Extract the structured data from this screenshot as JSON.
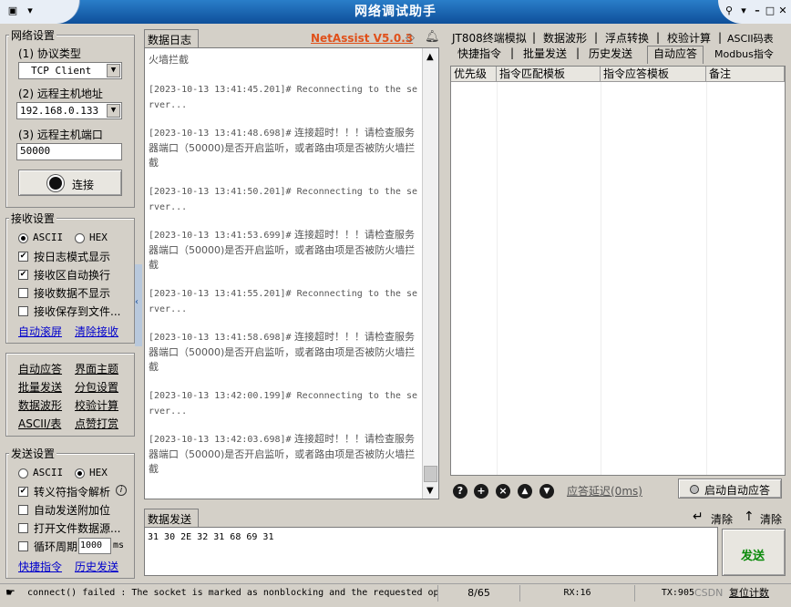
{
  "window": {
    "title": "网络调试助手"
  },
  "network_settings": {
    "title": "网络设置",
    "protocol_label": "(1) 协议类型",
    "protocol_value": "TCP Client",
    "host_label": "(2) 远程主机地址",
    "host_value": "192.168.0.133",
    "port_label": "(3) 远程主机端口",
    "port_value": "50000",
    "connect_label": "连接"
  },
  "receive_settings": {
    "title": "接收设置",
    "ascii_label": "ASCII",
    "hex_label": "HEX",
    "log_mode_label": "按日志模式显示",
    "auto_wrap_label": "接收区自动换行",
    "no_display_label": "接收数据不显示",
    "save_file_label": "接收保存到文件...",
    "auto_scroll_link": "自动滚屏",
    "clear_recv_link": "清除接收"
  },
  "tools": {
    "items": [
      "自动应答",
      "界面主题",
      "批量发送",
      "分包设置",
      "数据波形",
      "校验计算",
      "ASCII/表",
      "点赞打赏"
    ]
  },
  "send_settings": {
    "title": "发送设置",
    "ascii_label": "ASCII",
    "hex_label": "HEX",
    "escape_label": "转义符指令解析",
    "info_icon": "i",
    "auto_append_label": "自动发送附加位",
    "open_file_label": "打开文件数据源...",
    "cycle_label": "循环周期",
    "cycle_value": "1000",
    "cycle_unit": "ms",
    "shortcut_link": "快捷指令",
    "history_link": "历史发送"
  },
  "log_panel": {
    "tab": "数据日志",
    "brand": "NetAssist V5.0.3",
    "first_line": "火墙拦截",
    "entries": [
      {
        "ts": "[2023-10-13 13:41:45.201]#",
        "msg": " Reconnecting to the server..."
      },
      {
        "ts": "[2023-10-13 13:41:48.698]#",
        "msg": " 连接超时！！！请检查服务器端口（50000)是否开启监听，或者路由项是否被防火墙拦截"
      },
      {
        "ts": "[2023-10-13 13:41:50.201]#",
        "msg": " Reconnecting to the server..."
      },
      {
        "ts": "[2023-10-13 13:41:53.699]#",
        "msg": " 连接超时！！！请检查服务器端口（50000)是否开启监听，或者路由项是否被防火墙拦截"
      },
      {
        "ts": "[2023-10-13 13:41:55.201]#",
        "msg": " Reconnecting to the server..."
      },
      {
        "ts": "[2023-10-13 13:41:58.698]#",
        "msg": " 连接超时！！！请检查服务器端口（50000)是否开启监听，或者路由项是否被防火墙拦截"
      },
      {
        "ts": "[2023-10-13 13:42:00.199]#",
        "msg": " Reconnecting to the server..."
      },
      {
        "ts": "[2023-10-13 13:42:03.698]#",
        "msg": " 连接超时！！！请检查服务器端口（50000)是否开启监听，或者路由项是否被防火墙拦截"
      }
    ]
  },
  "right_panel": {
    "tabs_row1": [
      "JT808终端模拟",
      "数据波形",
      "浮点转换",
      "校验计算",
      "ASCII码表"
    ],
    "tabs_row2": [
      "快捷指令",
      "批量发送",
      "历史发送",
      "自动应答",
      "Modbus指令"
    ],
    "columns": [
      "优先级",
      "指令匹配模板",
      "指令应答模板",
      "备注"
    ],
    "delay_link": "应答延迟(0ms)",
    "start_button": "启动自动应答"
  },
  "send_panel": {
    "tab": "数据发送",
    "clear1": "清除",
    "clear2": "清除",
    "content": "31 30 2E 32 31 68 69 31",
    "send_button": "发送"
  },
  "status_bar": {
    "message": "connect() failed : The socket is marked as nonblocking and the requested op",
    "count": "8/65",
    "rx": "RX:16",
    "tx": "TX:905",
    "watermark": "CSDN",
    "reset": "复位计数"
  }
}
